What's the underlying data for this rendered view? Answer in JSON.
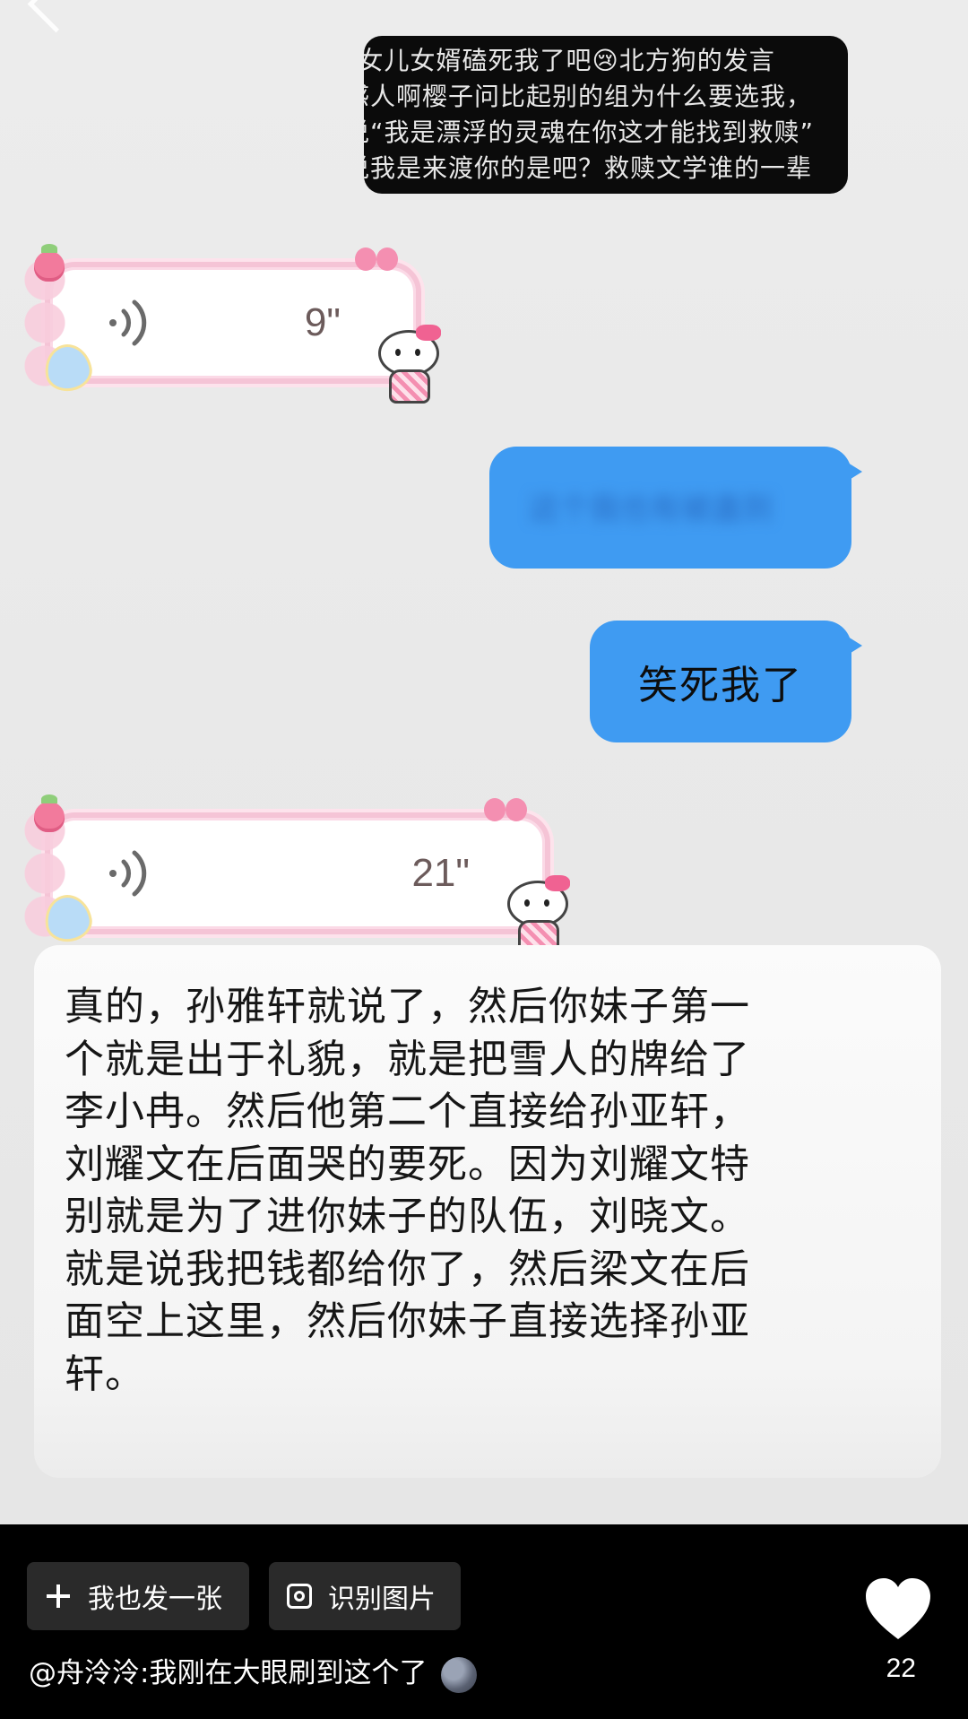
{
  "quote_screenshot": {
    "lines": [
      "”女儿女婿磕死我了吧😢北方狗的发言",
      "感人啊樱子问比起别的组为什么要选我，",
      "说“我是漂浮的灵魂在你这才能找到救赎”",
      "说我是来渡你的是吧？救赎文学谁的一辈"
    ]
  },
  "messages": {
    "voice_1": {
      "duration": "9\""
    },
    "blurred_bubble": {
      "text": "这个我也有被蛊到"
    },
    "sent_text": {
      "text": "笑死我了"
    },
    "voice_2": {
      "duration": "21\""
    }
  },
  "transcript": {
    "lines": [
      "真的，孙雅轩就说了，然后你妹子第一",
      "个就是出于礼貌，就是把雪人的牌给了",
      "李小冉。然后他第二个直接给孙亚轩，",
      "刘耀文在后面哭的要死。因为刘耀文特",
      "别就是为了进你妹子的队伍，刘晓文。",
      "就是说我把钱都给你了，然后梁文在后",
      "面空上这里，然后你妹子直接选择孙亚",
      "轩。"
    ]
  },
  "bottom_bar": {
    "post_button_label": "我也发一张",
    "recognize_button_label": "识别图片",
    "caption": "@舟泠泠:我刚在大眼刷到这个了",
    "like_count": "22"
  },
  "colors": {
    "chat_background": "#ececec",
    "blue_bubble": "#3f9bf2",
    "voice_border": "#f5c4d6",
    "bottom_bar": "#000000"
  },
  "icons": {
    "post": "plus-icon",
    "recognize": "scan-icon",
    "like": "heart-icon",
    "voice": "sound-wave-icon",
    "caption_emoji": "new-moon-face-icon",
    "back": "chevron-left-icon"
  }
}
